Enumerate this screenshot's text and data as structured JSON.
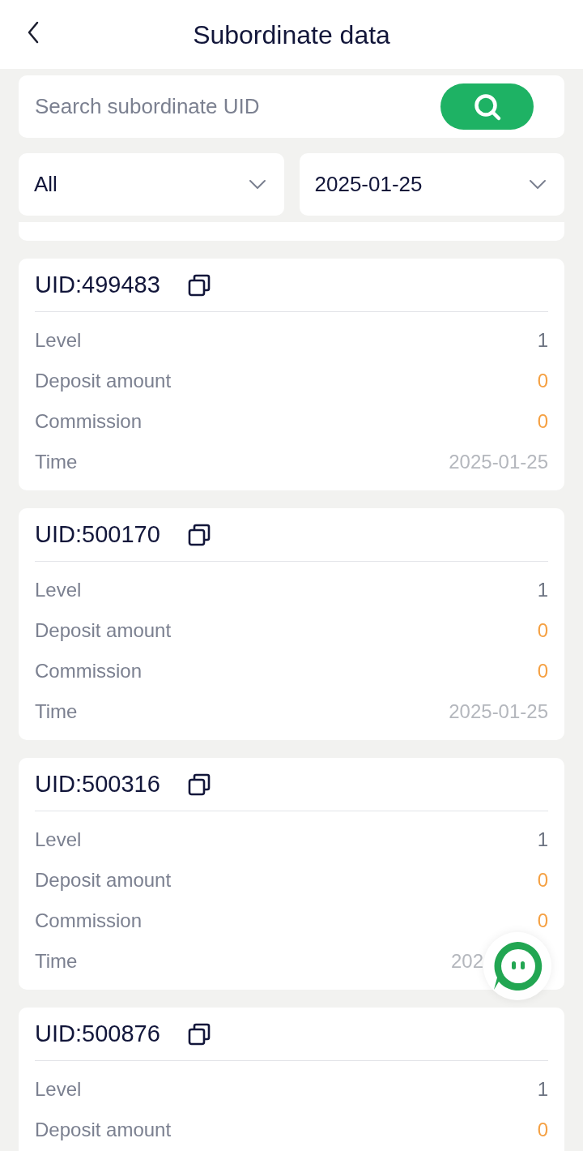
{
  "header": {
    "title": "Subordinate data"
  },
  "search": {
    "placeholder": "Search subordinate UID"
  },
  "filters": [
    {
      "value": "All"
    },
    {
      "value": "2025-01-25"
    }
  ],
  "records": [
    {
      "uid": "UID:499483",
      "rows": [
        {
          "label": "Level",
          "value": "1",
          "kind": "level"
        },
        {
          "label": "Deposit amount",
          "value": "0",
          "kind": "amount"
        },
        {
          "label": "Commission",
          "value": "0",
          "kind": "amount"
        },
        {
          "label": "Time",
          "value": "2025-01-25",
          "kind": "date"
        }
      ]
    },
    {
      "uid": "UID:500170",
      "rows": [
        {
          "label": "Level",
          "value": "1",
          "kind": "level"
        },
        {
          "label": "Deposit amount",
          "value": "0",
          "kind": "amount"
        },
        {
          "label": "Commission",
          "value": "0",
          "kind": "amount"
        },
        {
          "label": "Time",
          "value": "2025-01-25",
          "kind": "date"
        }
      ]
    },
    {
      "uid": "UID:500316",
      "rows": [
        {
          "label": "Level",
          "value": "1",
          "kind": "level"
        },
        {
          "label": "Deposit amount",
          "value": "0",
          "kind": "amount"
        },
        {
          "label": "Commission",
          "value": "0",
          "kind": "amount"
        },
        {
          "label": "Time",
          "value": "202",
          "kind": "date"
        }
      ]
    },
    {
      "uid": "UID:500876",
      "rows": [
        {
          "label": "Level",
          "value": "1",
          "kind": "level"
        },
        {
          "label": "Deposit amount",
          "value": "0",
          "kind": "amount"
        }
      ]
    }
  ]
}
